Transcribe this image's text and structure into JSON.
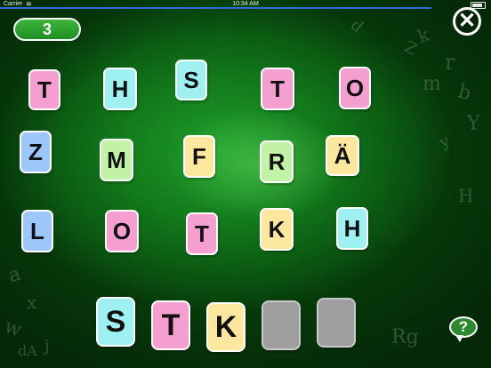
{
  "status_bar": {
    "carrier": "Carrier",
    "wifi_icon": "wifi-icon",
    "time": "10:34 AM",
    "battery_icon": "battery-icon"
  },
  "score": "3",
  "icons": {
    "close": "close-icon",
    "help": "help-icon"
  },
  "help_label": "?",
  "close_label": "✕",
  "background_letters": [
    "k",
    "r",
    "b",
    "m",
    "Z",
    "Y",
    "y",
    "d",
    "H",
    "a",
    "x",
    "w",
    "j",
    "Rg",
    "dA"
  ],
  "letter_grid": [
    {
      "letter": "T",
      "color": "#f59ed0"
    },
    {
      "letter": "H",
      "color": "#9ff1f1"
    },
    {
      "letter": "S",
      "color": "#9ff1f1"
    },
    {
      "letter": "T",
      "color": "#f59ed0"
    },
    {
      "letter": "O",
      "color": "#f59ed0"
    },
    {
      "letter": "Z",
      "color": "#9ec7f9"
    },
    {
      "letter": "M",
      "color": "#c2f2a5"
    },
    {
      "letter": "F",
      "color": "#fbe79d"
    },
    {
      "letter": "R",
      "color": "#c2f2a5"
    },
    {
      "letter": "Ä",
      "color": "#fbe79d"
    },
    {
      "letter": "L",
      "color": "#9ec7f9"
    },
    {
      "letter": "O",
      "color": "#f59ed0"
    },
    {
      "letter": "T",
      "color": "#f59ed0"
    },
    {
      "letter": "K",
      "color": "#fbe79d"
    },
    {
      "letter": "H",
      "color": "#9ff1f1"
    }
  ],
  "answer_slots": [
    {
      "letter": "S",
      "color": "#9ff1f1"
    },
    {
      "letter": "T",
      "color": "#f59ed0"
    },
    {
      "letter": "K",
      "color": "#fbe79d"
    },
    {
      "letter": "",
      "color": "#9e9e9e"
    },
    {
      "letter": "",
      "color": "#9e9e9e"
    }
  ]
}
